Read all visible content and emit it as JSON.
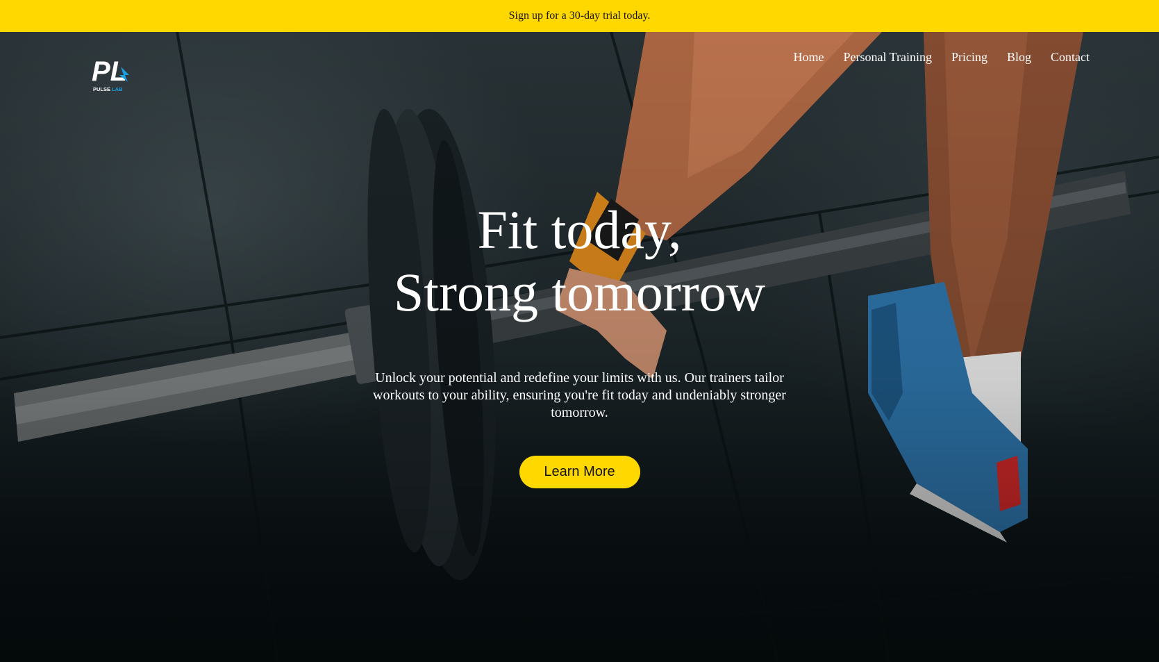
{
  "promo": {
    "text": "Sign up for a 30-day trial today."
  },
  "brand": {
    "logo_initials": "PL",
    "logo_word_1": "PULSE",
    "logo_word_2": "LAB"
  },
  "nav": {
    "items": [
      {
        "label": "Home"
      },
      {
        "label": "Personal Training"
      },
      {
        "label": "Pricing"
      },
      {
        "label": "Blog"
      },
      {
        "label": "Contact"
      }
    ]
  },
  "hero": {
    "headline_line_1": "Fit today,",
    "headline_line_2": "Strong tomorrow",
    "description": "Unlock your potential and redefine your limits with us. Our trainers tailor workouts to your ability, ensuring you're fit today and undeniably stronger tomorrow.",
    "cta_label": "Learn More"
  },
  "colors": {
    "accent": "#FFD800",
    "hero_text": "#FFFFFF",
    "promo_text": "#111111"
  }
}
